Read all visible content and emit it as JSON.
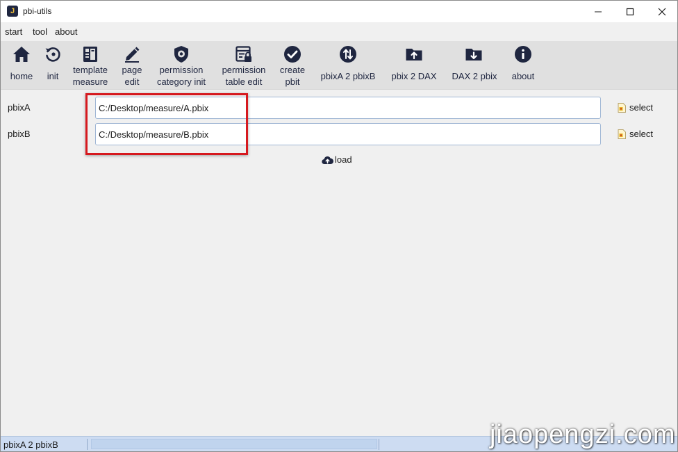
{
  "window": {
    "title": "pbi-utils",
    "app_icon_letter": "J"
  },
  "menu": {
    "items": [
      {
        "label": "start"
      },
      {
        "label": "tool"
      },
      {
        "label": "about"
      }
    ]
  },
  "toolbar": {
    "buttons": [
      {
        "label": "home",
        "icon": "home-icon"
      },
      {
        "label": "init",
        "icon": "refresh-icon"
      },
      {
        "line1": "template",
        "line2": "measure",
        "icon": "template-icon"
      },
      {
        "line1": "page",
        "line2": "edit",
        "icon": "pencil-icon"
      },
      {
        "line1": "permission",
        "line2": "category init",
        "icon": "shield-gear-icon"
      },
      {
        "line1": "permission",
        "line2": "table edit",
        "icon": "table-lock-icon"
      },
      {
        "line1": "create",
        "line2": "pbit",
        "icon": "check-circle-icon"
      },
      {
        "label": "pbixA 2 pbixB",
        "icon": "swap-icon"
      },
      {
        "label": "pbix 2 DAX",
        "icon": "folder-upload-icon"
      },
      {
        "label": "DAX 2 pbix",
        "icon": "folder-download-icon"
      },
      {
        "label": "about",
        "icon": "info-icon"
      }
    ]
  },
  "form": {
    "pbixA": {
      "label": "pbixA",
      "value": "C:/Desktop/measure/A.pbix",
      "select_label": "select"
    },
    "pbixB": {
      "label": "pbixB",
      "value": "C:/Desktop/measure/B.pbix",
      "select_label": "select"
    },
    "load_label": "load"
  },
  "status": {
    "text": "pbixA 2 pbixB"
  },
  "watermark": "jiaopengzi.com",
  "colors": {
    "icon": "#1f2640",
    "highlight": "#d6191f",
    "statusbar": "#cddcf2",
    "toolbar": "#e0e0e0"
  }
}
